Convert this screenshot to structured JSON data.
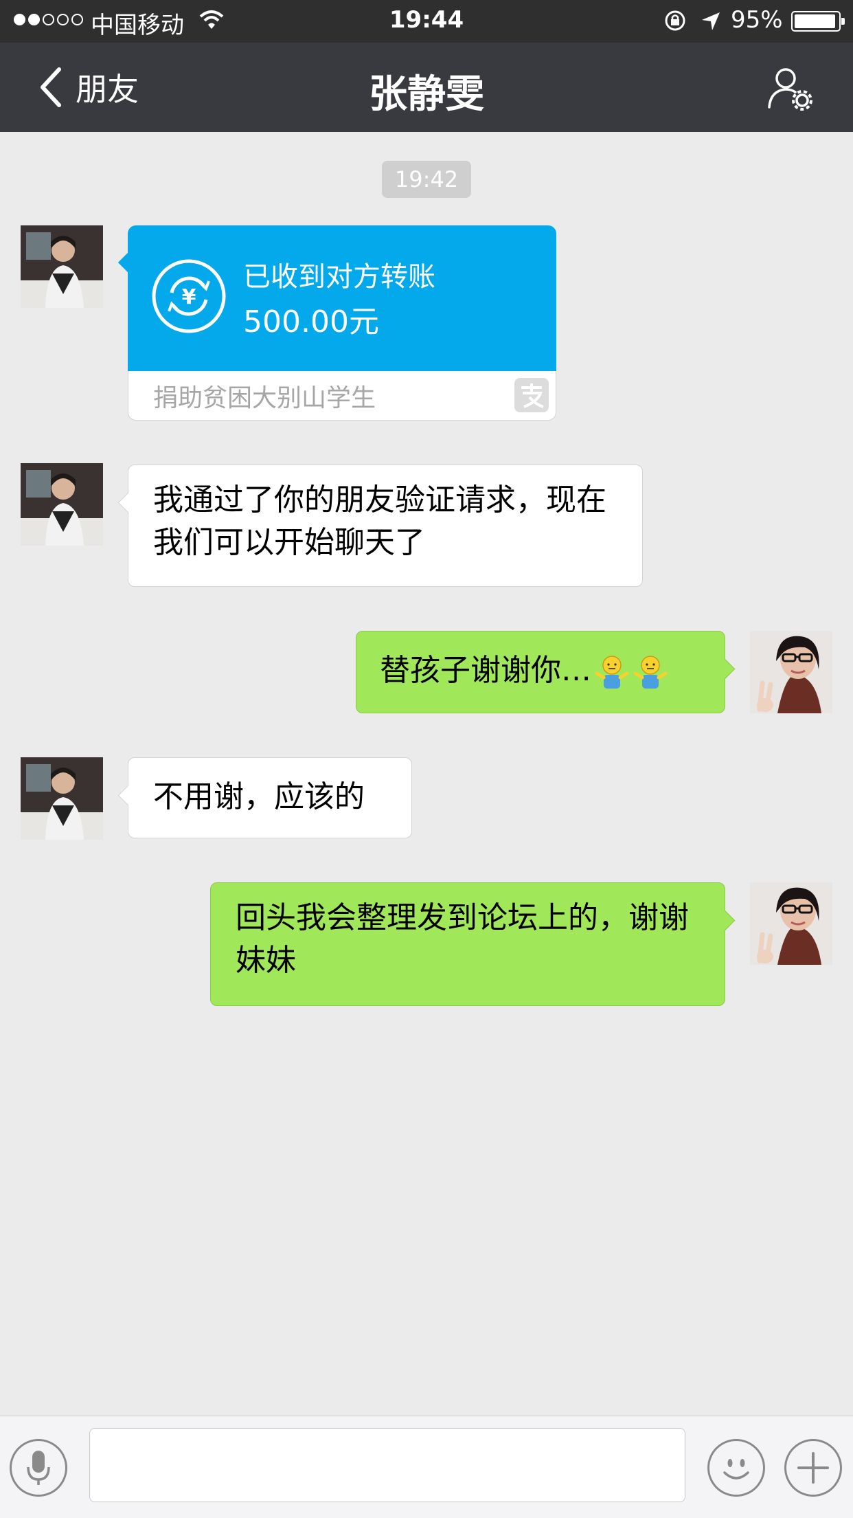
{
  "status_bar": {
    "carrier": "中国移动",
    "time": "19:44",
    "battery_percent": "95%",
    "battery_level": 0.95,
    "signal_bars_filled": 2,
    "signal_bars_total": 5,
    "icons": [
      "wifi-icon",
      "orientation-lock-icon",
      "location-arrow-icon",
      "battery-icon"
    ]
  },
  "nav": {
    "back_label": "朋友",
    "title": "张静雯",
    "icons": [
      "chevron-left-icon",
      "contact-settings-icon"
    ]
  },
  "chat": {
    "timestamp": "19:42",
    "transfer": {
      "status": "已收到对方转账",
      "amount": "500.00元",
      "memo": "捐助贫困大别山学生",
      "icons": [
        "yuan-transfer-icon",
        "alipay-icon"
      ],
      "color": "#03a9eb"
    },
    "messages": [
      {
        "from": "contact",
        "text": "我通过了你的朋友验证请求，现在我们可以开始聊天了"
      },
      {
        "from": "me",
        "text": "替孩子谢谢你…",
        "emojis": [
          "shrug-emoji-icon",
          "shrug-emoji-icon"
        ]
      },
      {
        "from": "contact",
        "text": "不用谢，应该的"
      },
      {
        "from": "me",
        "text": "回头我会整理发到论坛上的，谢谢妹妹"
      }
    ]
  },
  "input_bar": {
    "icons": [
      "voice-mic-icon",
      "emoji-smiley-icon",
      "plus-icon"
    ],
    "text_value": "",
    "placeholder": ""
  },
  "colors": {
    "nav_bg": "#393a3f",
    "chat_bg": "#ebebeb",
    "outgoing_bubble": "#a0e75a",
    "incoming_bubble": "#ffffff"
  }
}
